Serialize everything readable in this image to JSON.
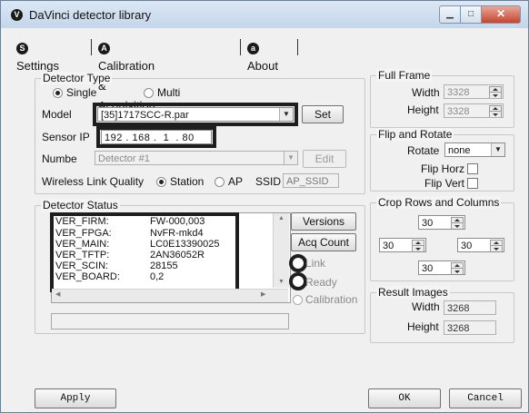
{
  "window": {
    "title": "DaVinci detector library",
    "app_icon": "V"
  },
  "tabs": [
    {
      "icon": "S",
      "label": "Settings"
    },
    {
      "icon": "A",
      "label": "Calibration & Acquisition"
    },
    {
      "icon": "a",
      "label": "About"
    }
  ],
  "detector_type": {
    "title": "Detector Type",
    "single_label": "Single",
    "multi_label": "Multi",
    "model_label": "Model",
    "model_value": "[35]1717SCC-R.par",
    "set_label": "Set",
    "sensor_ip_label": "Sensor IP",
    "ip": [
      "192",
      "168",
      "1",
      "80"
    ],
    "number_label": "Numbe",
    "number_value": "Detector #1",
    "edit_label": "Edit",
    "wireless_label": "Wireless Link Quality",
    "station_label": "Station",
    "ap_label": "AP",
    "ssid_label": "SSID",
    "ssid_value": "AP_SSID"
  },
  "detector_status": {
    "title": "Detector Status",
    "lines": [
      {
        "key": "VER_FIRM:",
        "value": "FW-000,003"
      },
      {
        "key": "VER_FPGA:",
        "value": "NvFR-mkd4"
      },
      {
        "key": "VER_MAIN:",
        "value": "LC0E13390025"
      },
      {
        "key": "VER_TFTP:",
        "value": "2AN36052R"
      },
      {
        "key": "VER_SCIN:",
        "value": "28155"
      },
      {
        "key": "VER_BOARD:",
        "value": "0,2"
      }
    ],
    "versions_label": "Versions",
    "acq_count_label": "Acq Count",
    "link_label": "Link",
    "ready_label": "Ready",
    "calibration_label": "Calibration"
  },
  "full_frame": {
    "title": "Full Frame",
    "width_label": "Width",
    "width_value": "3328",
    "height_label": "Height",
    "height_value": "3328"
  },
  "flip_rotate": {
    "title": "Flip and Rotate",
    "rotate_label": "Rotate",
    "rotate_value": "none",
    "flip_horz_label": "Flip Horz",
    "flip_vert_label": "Flip Vert"
  },
  "crop": {
    "title": "Crop Rows and Columns",
    "top": "30",
    "left": "30",
    "right": "30",
    "bottom": "30"
  },
  "result_images": {
    "title": "Result Images",
    "width_label": "Width",
    "width_value": "3268",
    "height_label": "Height",
    "height_value": "3268"
  },
  "buttons": {
    "apply": "Apply",
    "ok": "OK",
    "cancel": "Cancel"
  }
}
